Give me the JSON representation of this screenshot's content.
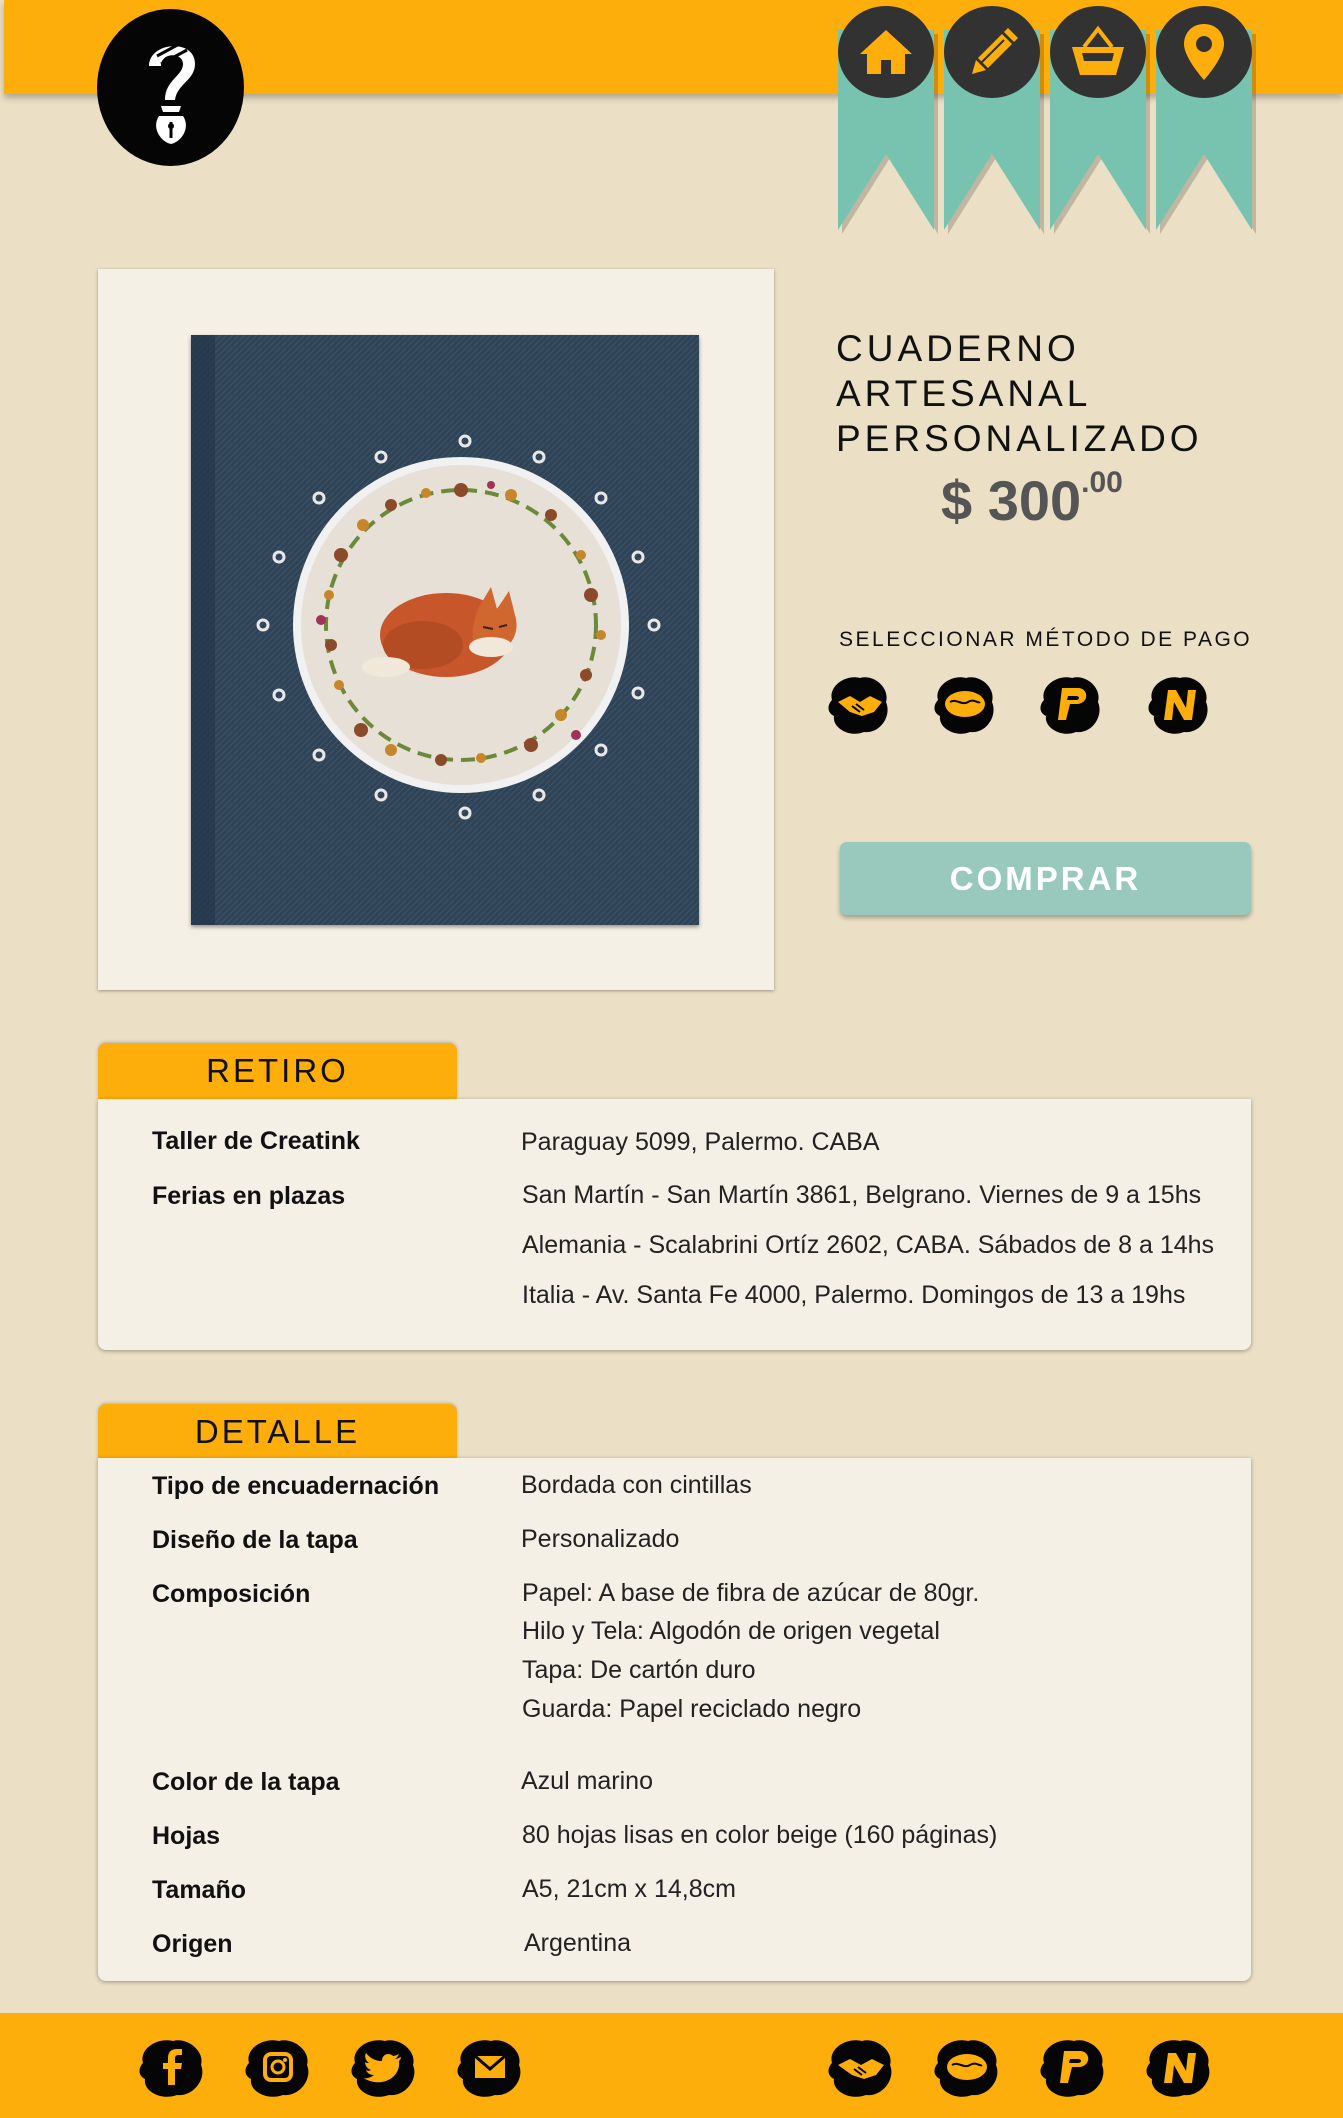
{
  "header": {
    "logo_alt": "Creatink",
    "nav": [
      {
        "id": "home",
        "icon": "home-icon"
      },
      {
        "id": "edit",
        "icon": "pencil-icon"
      },
      {
        "id": "cart",
        "icon": "basket-icon"
      },
      {
        "id": "location",
        "icon": "map-pin-icon"
      }
    ]
  },
  "product": {
    "title": "CUADERNO ARTESANAL PERSONALIZADO",
    "price_main": "$ 300",
    "price_cents": ".00",
    "payment_label": "SELECCIONAR MÉTODO DE PAGO",
    "payment_methods": [
      {
        "id": "cash",
        "icon": "handshake-icon"
      },
      {
        "id": "mercadopago",
        "icon": "mercadopago-icon"
      },
      {
        "id": "paypal",
        "icon": "paypal-icon"
      },
      {
        "id": "naranja",
        "icon": "naranja-icon"
      }
    ],
    "buy_label": "COMPRAR"
  },
  "retiro": {
    "title": "RETIRO",
    "rows": [
      {
        "key": "Taller de Creatink",
        "values": [
          "Paraguay 5099, Palermo. CABA"
        ]
      },
      {
        "key": "Ferias en plazas",
        "values": [
          "San Martín - San Martín 3861, Belgrano. Viernes de 9 a 15hs",
          "Alemania - Scalabrini Ortíz 2602, CABA. Sábados de 8 a 14hs",
          "Italia - Av. Santa Fe 4000, Palermo. Domingos de 13 a 19hs"
        ]
      }
    ]
  },
  "detalle": {
    "title": "DETALLE",
    "rows": [
      {
        "key": "Tipo de encuadernación",
        "values": [
          "Bordada con cintillas"
        ]
      },
      {
        "key": "Diseño de la tapa",
        "values": [
          "Personalizado"
        ]
      },
      {
        "key": "Composición",
        "values": [
          "Papel: A base de fibra de azúcar de 80gr.",
          "Hilo y Tela: Algodón de origen vegetal",
          "Tapa: De cartón duro",
          "Guarda: Papel reciclado negro"
        ]
      },
      {
        "key": "Color de la tapa",
        "values": [
          "Azul marino"
        ]
      },
      {
        "key": "Hojas",
        "values": [
          "80 hojas lisas en color beige (160 páginas)"
        ]
      },
      {
        "key": "Tamaño",
        "values": [
          "A5, 21cm x 14,8cm"
        ]
      },
      {
        "key": "Origen",
        "values": [
          "Argentina"
        ]
      }
    ]
  },
  "footer": {
    "social": [
      "facebook-icon",
      "instagram-icon",
      "twitter-icon",
      "mail-icon"
    ],
    "payments": [
      "handshake-icon",
      "mercadopago-icon",
      "paypal-icon",
      "naranja-icon"
    ]
  },
  "colors": {
    "background": "#ebdfc5",
    "accent_yellow": "#fdae0b",
    "ribbon_teal": "#77c3b0",
    "button_teal": "#98c9bc",
    "card": "#f5f0e6",
    "icon_dark": "#333232"
  }
}
